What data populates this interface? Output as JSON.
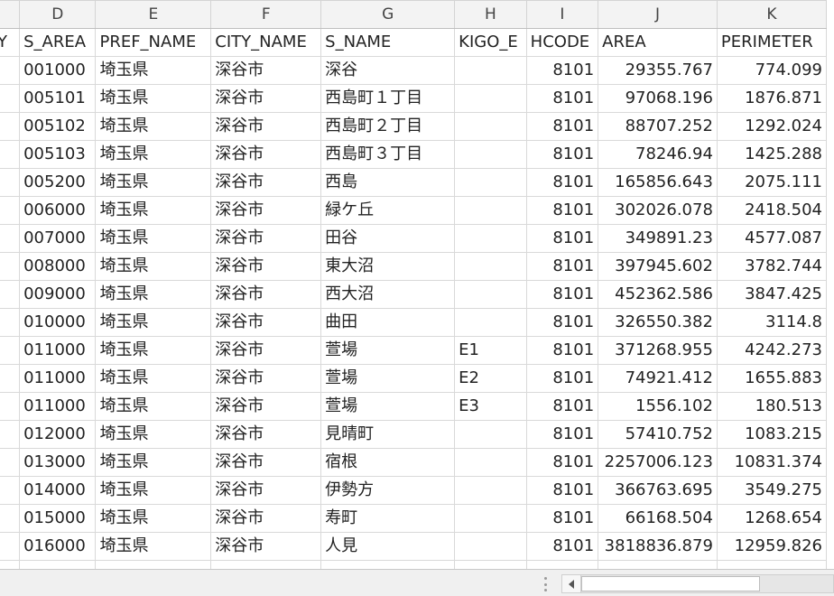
{
  "columns": [
    "",
    "D",
    "E",
    "F",
    "G",
    "H",
    "I",
    "J",
    "K"
  ],
  "header_row": [
    "Y",
    "S_AREA",
    "PREF_NAME",
    "CITY_NAME",
    "S_NAME",
    "KIGO_E",
    "HCODE",
    "AREA",
    "PERIMETER"
  ],
  "rows": [
    [
      "",
      "001000",
      "埼玉県",
      "深谷市",
      "深谷",
      "",
      "8101",
      "29355.767",
      "774.099"
    ],
    [
      "",
      "005101",
      "埼玉県",
      "深谷市",
      "西島町１丁目",
      "",
      "8101",
      "97068.196",
      "1876.871"
    ],
    [
      "",
      "005102",
      "埼玉県",
      "深谷市",
      "西島町２丁目",
      "",
      "8101",
      "88707.252",
      "1292.024"
    ],
    [
      "",
      "005103",
      "埼玉県",
      "深谷市",
      "西島町３丁目",
      "",
      "8101",
      "78246.94",
      "1425.288"
    ],
    [
      "",
      "005200",
      "埼玉県",
      "深谷市",
      "西島",
      "",
      "8101",
      "165856.643",
      "2075.111"
    ],
    [
      "",
      "006000",
      "埼玉県",
      "深谷市",
      "緑ケ丘",
      "",
      "8101",
      "302026.078",
      "2418.504"
    ],
    [
      "",
      "007000",
      "埼玉県",
      "深谷市",
      "田谷",
      "",
      "8101",
      "349891.23",
      "4577.087"
    ],
    [
      "",
      "008000",
      "埼玉県",
      "深谷市",
      "東大沼",
      "",
      "8101",
      "397945.602",
      "3782.744"
    ],
    [
      "",
      "009000",
      "埼玉県",
      "深谷市",
      "西大沼",
      "",
      "8101",
      "452362.586",
      "3847.425"
    ],
    [
      "",
      "010000",
      "埼玉県",
      "深谷市",
      "曲田",
      "",
      "8101",
      "326550.382",
      "3114.8"
    ],
    [
      "",
      "011000",
      "埼玉県",
      "深谷市",
      "萱場",
      "E1",
      "8101",
      "371268.955",
      "4242.273"
    ],
    [
      "",
      "011000",
      "埼玉県",
      "深谷市",
      "萱場",
      "E2",
      "8101",
      "74921.412",
      "1655.883"
    ],
    [
      "",
      "011000",
      "埼玉県",
      "深谷市",
      "萱場",
      "E3",
      "8101",
      "1556.102",
      "180.513"
    ],
    [
      "",
      "012000",
      "埼玉県",
      "深谷市",
      "見晴町",
      "",
      "8101",
      "57410.752",
      "1083.215"
    ],
    [
      "",
      "013000",
      "埼玉県",
      "深谷市",
      "宿根",
      "",
      "8101",
      "2257006.123",
      "10831.374"
    ],
    [
      "",
      "014000",
      "埼玉県",
      "深谷市",
      "伊勢方",
      "",
      "8101",
      "366763.695",
      "3549.275"
    ],
    [
      "",
      "015000",
      "埼玉県",
      "深谷市",
      "寿町",
      "",
      "8101",
      "66168.504",
      "1268.654"
    ],
    [
      "",
      "016000",
      "埼玉県",
      "深谷市",
      "人見",
      "",
      "8101",
      "3818836.879",
      "12959.826"
    ],
    [
      "",
      "",
      "",
      "",
      "",
      "",
      "",
      "",
      ""
    ]
  ],
  "align": [
    "txt",
    "txt",
    "txt",
    "txt",
    "txt",
    "txt",
    "num",
    "num",
    "num"
  ]
}
